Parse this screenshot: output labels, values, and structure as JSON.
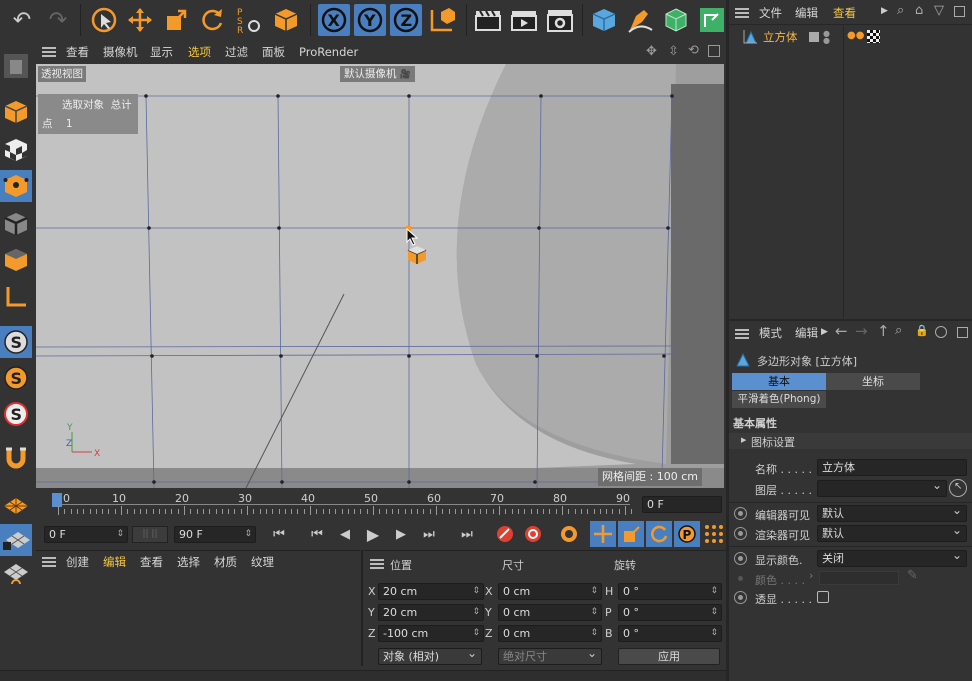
{
  "menu": {
    "items": [
      "查看",
      "摄像机",
      "显示",
      "选项",
      "过滤",
      "面板",
      "ProRender"
    ],
    "selected": "选项"
  },
  "viewport": {
    "view_name": "透视视图",
    "camera": "默认摄像机",
    "stats_header": "选取对象  总计",
    "stats_row": "点    1",
    "grid_spacing": "网格间距 : 100 cm"
  },
  "timeline": {
    "ticks": [
      "0",
      "10",
      "20",
      "30",
      "40",
      "50",
      "60",
      "70",
      "80",
      "90"
    ],
    "current_frame": "0 F",
    "start_frame": "0 F",
    "end_frame": "90 F"
  },
  "materials": {
    "tabs": [
      "创建",
      "编辑",
      "查看",
      "选择",
      "材质",
      "纹理"
    ]
  },
  "coords": {
    "headers": [
      "位置",
      "尺寸",
      "旋转"
    ],
    "rows": [
      {
        "axis": "X",
        "pos": "20 cm",
        "size_axis": "X",
        "size": "0 cm",
        "rot_axis": "H",
        "rot": "0 °"
      },
      {
        "axis": "Y",
        "pos": "20 cm",
        "size_axis": "Y",
        "size": "0 cm",
        "rot_axis": "P",
        "rot": "0 °"
      },
      {
        "axis": "Z",
        "pos": "-100 cm",
        "size_axis": "Z",
        "size": "0 cm",
        "rot_axis": "B",
        "rot": "0 °"
      }
    ],
    "mode": "对象 (相对)",
    "size_mode": "绝对尺寸",
    "apply": "应用"
  },
  "objects": {
    "menu": [
      "文件",
      "编辑",
      "查看"
    ],
    "selected": "查看",
    "item": "立方体"
  },
  "attributes": {
    "menu": [
      "模式",
      "编辑"
    ],
    "object_title": "多边形对象 [立方体]",
    "tabs": [
      "基本",
      "坐标"
    ],
    "phong": "平滑着色(Phong)",
    "section": "基本属性",
    "icon_settings": "图标设置",
    "name_label": "名称 . . . . .",
    "name_value": "立方体",
    "layer_label": "图层 . . . . .",
    "editor_vis_label": "编辑器可见",
    "editor_vis_value": "默认",
    "render_vis_label": "渲染器可见",
    "render_vis_value": "默认",
    "display_color_label": "显示颜色.",
    "display_color_value": "关闭",
    "color_label": "颜色 . . . .",
    "xray_label": "透显 . . . . ."
  },
  "colors": {
    "accent_orange": "#f39a2b",
    "active_blue": "#4a7fbf",
    "selected_yellow": "#f5c842"
  }
}
